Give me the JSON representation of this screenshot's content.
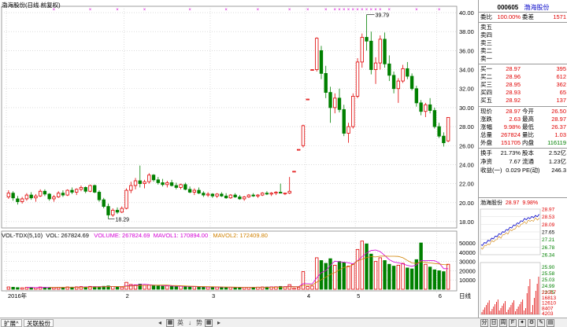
{
  "chart_header": "渤海股份(日线 前复权)",
  "volume_header": {
    "name": "VOL-TDX(5,10)",
    "vol_label": "VOL: 267824.69",
    "volume_label": "VOLUME: 267824.69",
    "mavol1_label": "MAVOL1: 170894.00",
    "mavol2_label": "MAVOL2: 172409.80"
  },
  "price_axis_labels": [
    "40.00",
    "38.00",
    "36.00",
    "34.00",
    "32.00",
    "30.00",
    "28.00",
    "26.00",
    "24.00",
    "22.00",
    "20.00",
    "18.00"
  ],
  "volume_axis_labels": [
    "50000",
    "40000",
    "30000",
    "20000",
    "10000"
  ],
  "x_axis_labels": [
    "2016年",
    "2",
    "3",
    "4",
    "5",
    "6"
  ],
  "x_axis_unit": "日线",
  "annotations": {
    "high": "39.79",
    "low": "18.29"
  },
  "quote_panel": {
    "code": "000605",
    "name": "渤海股份",
    "weibi_label": "委比",
    "weibi_value": "100.00%",
    "weicha_label": "委差",
    "weicha_value": "1571",
    "sell_levels": [
      {
        "label": "卖五",
        "price": "",
        "vol": ""
      },
      {
        "label": "卖四",
        "price": "",
        "vol": ""
      },
      {
        "label": "卖三",
        "price": "",
        "vol": ""
      },
      {
        "label": "卖二",
        "price": "",
        "vol": ""
      },
      {
        "label": "卖一",
        "price": "",
        "vol": ""
      }
    ],
    "buy_levels": [
      {
        "label": "买一",
        "price": "28.97",
        "vol": "395"
      },
      {
        "label": "买二",
        "price": "28.96",
        "vol": "612"
      },
      {
        "label": "买三",
        "price": "28.95",
        "vol": "362"
      },
      {
        "label": "买四",
        "price": "28.93",
        "vol": "65"
      },
      {
        "label": "买五",
        "price": "28.92",
        "vol": "137"
      }
    ],
    "stats": [
      {
        "k1": "现价",
        "v1": "28.97",
        "c1": "red",
        "k2": "今开",
        "v2": "26.50",
        "c2": "red"
      },
      {
        "k1": "涨跌",
        "v1": "2.63",
        "c1": "red",
        "k2": "最高",
        "v2": "28.97",
        "c2": "red"
      },
      {
        "k1": "涨幅",
        "v1": "9.98%",
        "c1": "red",
        "k2": "最低",
        "v2": "26.37",
        "c2": "red"
      },
      {
        "k1": "总量",
        "v1": "267824",
        "c1": "red",
        "k2": "量比",
        "v2": "1.03",
        "c2": "red"
      },
      {
        "k1": "外盘",
        "v1": "151705",
        "c1": "red",
        "k2": "内盘",
        "v2": "116119",
        "c2": "grn"
      }
    ],
    "stats2": [
      {
        "k1": "换手",
        "v1": "21.73%",
        "k2": "股本",
        "v2": "2.52亿"
      },
      {
        "k1": "净资",
        "v1": "7.67",
        "k2": "流通",
        "v2": "1.23亿"
      },
      {
        "k1": "收益(一)",
        "v1": "0.029",
        "k2": "PE(动)",
        "v2": "246.3"
      }
    ]
  },
  "mini_chart": {
    "title_name": "渤海股份",
    "title_price": "28.97",
    "title_pct": "9.98%",
    "price_labels": [
      "28.97",
      "28.53",
      "28.09",
      "27.65",
      "27.21",
      "26.78",
      "26.34"
    ],
    "pct_labels": [
      "25.90",
      "25.58",
      "25.03",
      "24.99",
      "22.75"
    ],
    "vol_labels": [
      "21017",
      "16813",
      "12610",
      "8407",
      "4203"
    ]
  },
  "status_bar": {
    "tab1": "扩展^",
    "tab2": "关联股份",
    "icon_labels": [
      "英",
      "势"
    ]
  },
  "colors": {
    "up": "#e00000",
    "down": "#008000",
    "ma5": "#d400d4",
    "ma10": "#d08000",
    "grid": "#c8c8c8"
  },
  "chart_data": {
    "type": "candlestick",
    "y_range": [
      17.5,
      40.5
    ],
    "x_ticks": [
      {
        "index": 0,
        "label": "2016年"
      },
      {
        "index": 26,
        "label": "2"
      },
      {
        "index": 45,
        "label": "3"
      },
      {
        "index": 66,
        "label": "4"
      },
      {
        "index": 77,
        "label": "5"
      },
      {
        "index": 95,
        "label": "6"
      }
    ],
    "candles": [
      [
        20.6,
        21.3,
        20.4,
        21.0
      ],
      [
        21.0,
        21.2,
        20.2,
        20.5
      ],
      [
        20.4,
        20.7,
        19.8,
        20.1
      ],
      [
        20.1,
        20.6,
        19.9,
        20.4
      ],
      [
        20.4,
        21.0,
        20.2,
        20.8
      ],
      [
        20.8,
        21.1,
        20.3,
        20.5
      ],
      [
        20.5,
        20.9,
        20.1,
        20.7
      ],
      [
        20.7,
        21.4,
        20.6,
        21.2
      ],
      [
        21.2,
        21.4,
        20.7,
        20.9
      ],
      [
        20.9,
        21.0,
        20.2,
        20.4
      ],
      [
        20.4,
        20.8,
        20.1,
        20.6
      ],
      [
        20.6,
        21.2,
        20.5,
        21.0
      ],
      [
        21.0,
        21.3,
        20.6,
        20.8
      ],
      [
        20.8,
        21.4,
        20.7,
        21.3
      ],
      [
        21.3,
        21.6,
        20.9,
        21.1
      ],
      [
        21.1,
        21.5,
        20.8,
        21.4
      ],
      [
        21.4,
        21.8,
        21.2,
        21.6
      ],
      [
        21.6,
        21.7,
        21.0,
        21.2
      ],
      [
        21.2,
        21.9,
        21.1,
        21.8
      ],
      [
        21.8,
        21.9,
        21.0,
        21.1
      ],
      [
        21.1,
        21.3,
        20.1,
        20.3
      ],
      [
        20.3,
        20.5,
        19.4,
        19.6
      ],
      [
        19.6,
        19.9,
        18.29,
        18.7
      ],
      [
        18.7,
        19.4,
        18.5,
        19.2
      ],
      [
        19.2,
        19.5,
        18.8,
        19.0
      ],
      [
        19.0,
        19.6,
        18.9,
        19.4
      ],
      [
        19.4,
        21.5,
        19.3,
        21.3
      ],
      [
        21.3,
        22.2,
        21.0,
        21.8
      ],
      [
        21.8,
        22.6,
        21.4,
        22.3
      ],
      [
        22.3,
        23.9,
        21.6,
        22.0
      ],
      [
        22.0,
        22.4,
        21.5,
        22.2
      ],
      [
        22.2,
        23.1,
        22.0,
        22.9
      ],
      [
        22.9,
        23.0,
        22.2,
        22.4
      ],
      [
        22.4,
        22.7,
        21.9,
        22.1
      ],
      [
        22.1,
        22.5,
        21.7,
        21.9
      ],
      [
        21.9,
        22.3,
        21.6,
        22.1
      ],
      [
        22.1,
        22.4,
        21.7,
        21.8
      ],
      [
        21.8,
        22.1,
        21.4,
        21.6
      ],
      [
        21.6,
        22.0,
        21.4,
        21.9
      ],
      [
        21.9,
        22.1,
        21.3,
        21.4
      ],
      [
        21.4,
        21.7,
        21.0,
        21.1
      ],
      [
        21.1,
        21.5,
        20.8,
        21.3
      ],
      [
        21.3,
        21.6,
        20.9,
        21.0
      ],
      [
        21.0,
        21.2,
        20.6,
        20.8
      ],
      [
        20.8,
        21.1,
        20.6,
        20.9
      ],
      [
        20.9,
        21.0,
        20.5,
        20.7
      ],
      [
        20.7,
        21.0,
        20.5,
        20.9
      ],
      [
        20.9,
        21.1,
        20.6,
        20.7
      ],
      [
        20.7,
        21.0,
        20.4,
        20.5
      ],
      [
        20.5,
        20.9,
        20.4,
        20.8
      ],
      [
        20.8,
        21.0,
        20.5,
        20.6
      ],
      [
        20.6,
        20.8,
        20.3,
        20.4
      ],
      [
        20.4,
        20.7,
        20.2,
        20.6
      ],
      [
        20.6,
        20.9,
        20.5,
        20.8
      ],
      [
        20.8,
        21.0,
        20.6,
        20.7
      ],
      [
        20.7,
        20.9,
        20.5,
        20.8
      ],
      [
        20.8,
        21.1,
        20.7,
        21.0
      ],
      [
        21.0,
        21.2,
        20.8,
        20.9
      ],
      [
        20.9,
        21.1,
        20.7,
        21.0
      ],
      [
        21.0,
        21.2,
        20.8,
        21.1
      ],
      [
        21.1,
        22.0,
        21.0,
        21.0
      ],
      [
        21.0,
        21.0,
        20.8,
        21.0
      ],
      [
        21.0,
        22.7,
        20.9,
        21.2
      ],
      [
        23.3,
        23.3,
        23.3,
        23.3
      ],
      [
        25.6,
        25.6,
        25.6,
        25.6
      ],
      [
        26.0,
        28.2,
        25.8,
        28.1
      ],
      [
        30.9,
        30.9,
        30.9,
        30.9
      ],
      [
        34.0,
        34.0,
        34.0,
        34.0
      ],
      [
        34.0,
        37.4,
        33.8,
        37.3
      ],
      [
        36.0,
        36.5,
        33.0,
        33.6
      ],
      [
        33.6,
        34.4,
        31.0,
        31.6
      ],
      [
        31.6,
        32.2,
        28.4,
        30.0
      ],
      [
        30.0,
        31.5,
        29.4,
        31.0
      ],
      [
        31.0,
        32.0,
        29.5,
        29.8
      ],
      [
        29.8,
        30.3,
        27.0,
        27.3
      ],
      [
        27.3,
        28.4,
        26.3,
        28.0
      ],
      [
        28.0,
        31.5,
        27.8,
        31.2
      ],
      [
        31.2,
        35.2,
        31.0,
        34.8
      ],
      [
        34.8,
        37.8,
        34.2,
        37.4
      ],
      [
        37.4,
        39.79,
        36.0,
        37.0
      ],
      [
        37.0,
        38.0,
        33.5,
        34.0
      ],
      [
        34.0,
        35.3,
        32.5,
        34.7
      ],
      [
        34.7,
        37.6,
        34.0,
        37.2
      ],
      [
        37.2,
        37.9,
        34.2,
        34.6
      ],
      [
        34.6,
        35.5,
        32.8,
        33.4
      ],
      [
        33.4,
        33.8,
        31.5,
        32.0
      ],
      [
        32.0,
        33.1,
        30.5,
        32.8
      ],
      [
        32.8,
        34.5,
        32.6,
        34.1
      ],
      [
        34.1,
        34.8,
        33.0,
        33.3
      ],
      [
        33.3,
        33.6,
        31.8,
        32.0
      ],
      [
        32.0,
        32.3,
        30.1,
        30.5
      ],
      [
        30.5,
        30.8,
        29.2,
        29.6
      ],
      [
        29.6,
        30.5,
        29.0,
        30.3
      ],
      [
        30.3,
        31.0,
        29.4,
        29.7
      ],
      [
        29.7,
        30.0,
        27.8,
        28.0
      ],
      [
        28.0,
        28.4,
        26.8,
        27.0
      ],
      [
        27.0,
        27.4,
        25.9,
        26.3
      ],
      [
        26.5,
        28.97,
        26.37,
        28.97
      ]
    ],
    "volumes": [
      2500,
      2200,
      1800,
      1600,
      2100,
      1900,
      1700,
      2400,
      2000,
      1800,
      1700,
      2200,
      2000,
      2500,
      2300,
      2600,
      2900,
      2400,
      3100,
      2800,
      2700,
      3200,
      3600,
      2900,
      2500,
      2400,
      7500,
      5200,
      4800,
      5600,
      4200,
      4600,
      3800,
      3500,
      3300,
      3600,
      3200,
      3000,
      3300,
      2900,
      2600,
      2800,
      2500,
      2300,
      2400,
      2200,
      2300,
      2100,
      2000,
      2200,
      2100,
      1900,
      2000,
      2200,
      2100,
      2300,
      2500,
      2400,
      2600,
      2700,
      3100,
      2900,
      5000,
      1200,
      2000,
      19000,
      3000,
      3500,
      34000,
      31000,
      28000,
      33000,
      26000,
      30000,
      29000,
      25000,
      27000,
      43000,
      52000,
      49000,
      38000,
      30000,
      34000,
      31000,
      27000,
      25000,
      26000,
      28000,
      23000,
      22000,
      32000,
      50000,
      27000,
      24000,
      21000,
      20000,
      19000,
      27000
    ],
    "volume_range": [
      0,
      56000
    ]
  }
}
